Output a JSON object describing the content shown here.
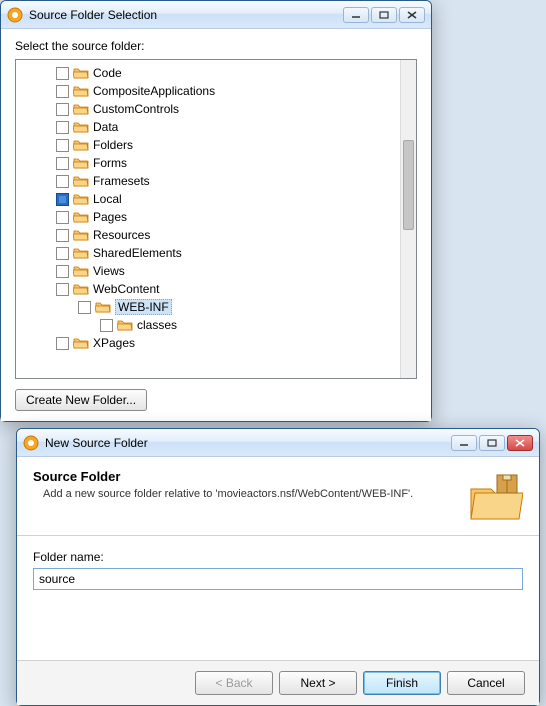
{
  "window1": {
    "title": "Source Folder Selection",
    "prompt": "Select the source folder:",
    "create_btn": "Create New Folder...",
    "tree": [
      {
        "label": "Code",
        "level": 1,
        "checked": false,
        "selected": false
      },
      {
        "label": "CompositeApplications",
        "level": 1,
        "checked": false,
        "selected": false
      },
      {
        "label": "CustomControls",
        "level": 1,
        "checked": false,
        "selected": false
      },
      {
        "label": "Data",
        "level": 1,
        "checked": false,
        "selected": false
      },
      {
        "label": "Folders",
        "level": 1,
        "checked": false,
        "selected": false
      },
      {
        "label": "Forms",
        "level": 1,
        "checked": false,
        "selected": false
      },
      {
        "label": "Framesets",
        "level": 1,
        "checked": false,
        "selected": false
      },
      {
        "label": "Local",
        "level": 1,
        "checked": true,
        "selected": false
      },
      {
        "label": "Pages",
        "level": 1,
        "checked": false,
        "selected": false
      },
      {
        "label": "Resources",
        "level": 1,
        "checked": false,
        "selected": false
      },
      {
        "label": "SharedElements",
        "level": 1,
        "checked": false,
        "selected": false
      },
      {
        "label": "Views",
        "level": 1,
        "checked": false,
        "selected": false
      },
      {
        "label": "WebContent",
        "level": 1,
        "checked": false,
        "selected": false
      },
      {
        "label": "WEB-INF",
        "level": 2,
        "checked": false,
        "selected": true
      },
      {
        "label": "classes",
        "level": 3,
        "checked": false,
        "selected": false
      },
      {
        "label": "XPages",
        "level": 1,
        "checked": false,
        "selected": false
      }
    ]
  },
  "window2": {
    "title": "New Source Folder",
    "header_title": "Source Folder",
    "header_desc": "Add a new source folder relative to 'movieactors.nsf/WebContent/WEB-INF'.",
    "field_label": "Folder name:",
    "field_value": "source",
    "buttons": {
      "back": "< Back",
      "next": "Next >",
      "finish": "Finish",
      "cancel": "Cancel"
    }
  }
}
